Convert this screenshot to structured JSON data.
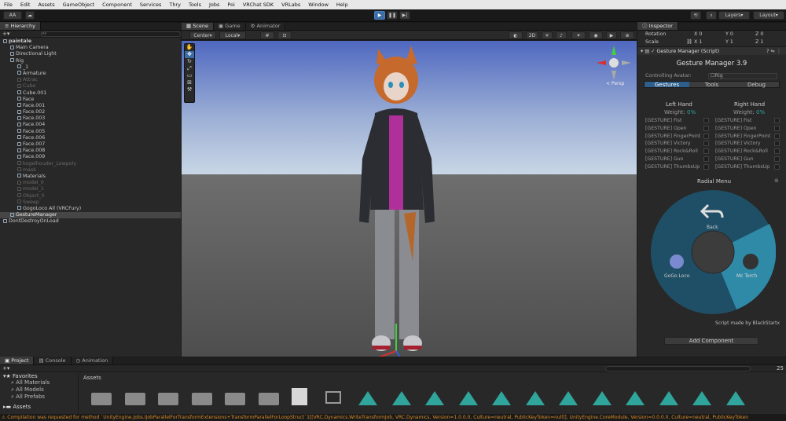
{
  "menubar": {
    "items": [
      "File",
      "Edit",
      "Assets",
      "GameObject",
      "Component",
      "Services",
      "Thry",
      "Tools",
      "Jobs",
      "Poi",
      "VRChat SDK",
      "VRLabs",
      "Window",
      "Help"
    ]
  },
  "toolbar": {
    "account": "AA",
    "layers": "Layers",
    "layout": "Layout",
    "play_icon": "▶",
    "pause_icon": "❚❚",
    "step_icon": "▶|"
  },
  "hierarchy": {
    "tab": "Hierarchy",
    "search_placeholder": "All",
    "rows": [
      {
        "label": "paintale",
        "indent": 0,
        "dim": false,
        "bold": true
      },
      {
        "label": "Main Camera",
        "indent": 1,
        "dim": false
      },
      {
        "label": "Directional Light",
        "indent": 1,
        "dim": false
      },
      {
        "label": "Rig",
        "indent": 1,
        "dim": false
      },
      {
        "label": "_1",
        "indent": 2,
        "dim": false
      },
      {
        "label": "Armature",
        "indent": 2,
        "dim": false
      },
      {
        "label": "Attrac",
        "indent": 2,
        "dim": true
      },
      {
        "label": "Cube",
        "indent": 2,
        "dim": true
      },
      {
        "label": "Cube.001",
        "indent": 2,
        "dim": false
      },
      {
        "label": "Face",
        "indent": 2,
        "dim": false
      },
      {
        "label": "Face.001",
        "indent": 2,
        "dim": false
      },
      {
        "label": "Face.002",
        "indent": 2,
        "dim": false
      },
      {
        "label": "Face.003",
        "indent": 2,
        "dim": false
      },
      {
        "label": "Face.004",
        "indent": 2,
        "dim": false
      },
      {
        "label": "Face.005",
        "indent": 2,
        "dim": false
      },
      {
        "label": "Face.006",
        "indent": 2,
        "dim": false
      },
      {
        "label": "Face.007",
        "indent": 2,
        "dim": false
      },
      {
        "label": "Face.008",
        "indent": 2,
        "dim": false
      },
      {
        "label": "Face.009",
        "indent": 2,
        "dim": false
      },
      {
        "label": "kogelhouder_Lowpoly",
        "indent": 2,
        "dim": true
      },
      {
        "label": "mask",
        "indent": 2,
        "dim": true
      },
      {
        "label": "Materials",
        "indent": 2,
        "dim": false
      },
      {
        "label": "model_0",
        "indent": 2,
        "dim": true
      },
      {
        "label": "model_1",
        "indent": 2,
        "dim": true
      },
      {
        "label": "Object_0",
        "indent": 2,
        "dim": true
      },
      {
        "label": "Sweep",
        "indent": 2,
        "dim": true
      },
      {
        "label": "GogoLoco All (VRCFury)",
        "indent": 2,
        "dim": false
      },
      {
        "label": "GestureManager",
        "indent": 1,
        "dim": false,
        "selected": true
      },
      {
        "label": "DontDestroyOnLoad",
        "indent": 0,
        "dim": false
      }
    ]
  },
  "scene": {
    "tabs": [
      "Scene",
      "Game",
      "Animator"
    ],
    "pivot": "Center",
    "space": "Local",
    "view_mode": "2D",
    "gizmo_label": "< Persp"
  },
  "inspector": {
    "tab": "Inspector",
    "rotation_label": "Rotation",
    "scale_label": "Scale",
    "rotation": {
      "x": "0",
      "y": "0",
      "z": "0"
    },
    "scale": {
      "x": "1",
      "y": "1",
      "z": "1"
    },
    "component_title": "Gesture Manager (Script)",
    "gm_title": "Gesture Manager 3.9",
    "controlling_label": "Controlling Avatar:",
    "controlling_value": "Rig",
    "tabs": [
      "Gestures",
      "Tools",
      "Debug"
    ],
    "left_hand": "Left Hand",
    "right_hand": "Right Hand",
    "weight_label": "Weight:",
    "weight_value": "0%",
    "gestures": [
      "[GESTURE] Fist",
      "[GESTURE] Open",
      "[GESTURE] FingerPoint",
      "[GESTURE] Victory",
      "[GESTURE] Rock&Roll",
      "[GESTURE] Gun",
      "[GESTURE] ThumbsUp"
    ],
    "radial_title": "Radial Menu",
    "radial": {
      "back": "Back",
      "gogo": "GoGo Loco",
      "mc": "Mc Torch"
    },
    "credit": "Script made by BlackStartx",
    "add_component": "Add Component"
  },
  "project": {
    "tabs": [
      "Project",
      "Console",
      "Animation"
    ],
    "favorites": "Favorites",
    "fav_items": [
      "All Materials",
      "All Models",
      "All Prefabs"
    ],
    "assets_root": "Assets",
    "assets_header": "Assets",
    "hidden_count": "25"
  },
  "status": "Compilation was requested for method `UnityEngine.Jobs.IJobParallelForTransformExtensions+TransformParallelForLoopStruct`1[[VRC.Dynamics.WriteTransformJob, VRC.Dynamics, Version=1.0.0.0, Culture=neutral, PublicKeyToken=null]], UnityEngine.CoreModule, Version=0.0.0.0, Culture=neutral, PublicKeyToken"
}
